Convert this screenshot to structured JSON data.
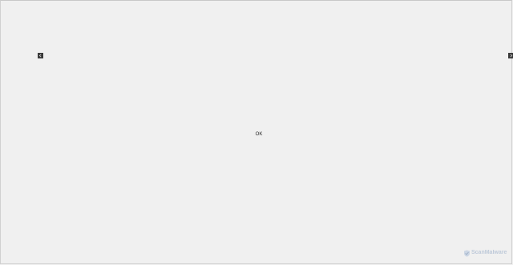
{
  "dialog": {
    "title": "",
    "ok_label": "OK"
  },
  "navigation": {
    "prev_icon": "left-arrow-icon",
    "next_icon": "right-arrow-icon"
  },
  "watermark": {
    "text": "ScanMalware"
  },
  "colors": {
    "background": "#f0f0f0",
    "nav_button": "#3a3a3a",
    "watermark": "#b7c4d6"
  }
}
